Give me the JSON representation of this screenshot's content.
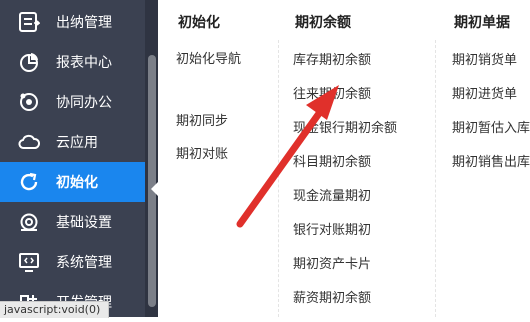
{
  "sidebar": {
    "items": [
      {
        "label": "出纳管理",
        "icon": "cashier-icon"
      },
      {
        "label": "报表中心",
        "icon": "pie-chart-icon"
      },
      {
        "label": "协同办公",
        "icon": "collaboration-icon"
      },
      {
        "label": "云应用",
        "icon": "cloud-icon"
      },
      {
        "label": "初始化",
        "icon": "refresh-icon",
        "active": true
      },
      {
        "label": "基础设置",
        "icon": "settings-icon"
      },
      {
        "label": "系统管理",
        "icon": "system-monitor-icon"
      },
      {
        "label": "开发管理",
        "icon": "developer-icon"
      }
    ]
  },
  "status_bar": "javascript:void(0)",
  "menu": {
    "columns": [
      {
        "header": "初始化",
        "items": [
          "初始化导航",
          "期初同步",
          "期初对账"
        ]
      },
      {
        "header": "期初余额",
        "items": [
          "库存期初余额",
          "往来期初余额",
          "现金银行期初余额",
          "科目期初余额",
          "现金流量期初",
          "银行对账期初",
          "期初资产卡片",
          "薪资期初余额"
        ]
      },
      {
        "header": "期初单据",
        "items": [
          "期初销货单",
          "期初进货单",
          "期初暂估入库",
          "期初销售出库"
        ]
      }
    ]
  },
  "colors": {
    "sidebar_bg": "#3b4151",
    "active_bg": "#1a86ee",
    "arrow": "#e0302b"
  }
}
